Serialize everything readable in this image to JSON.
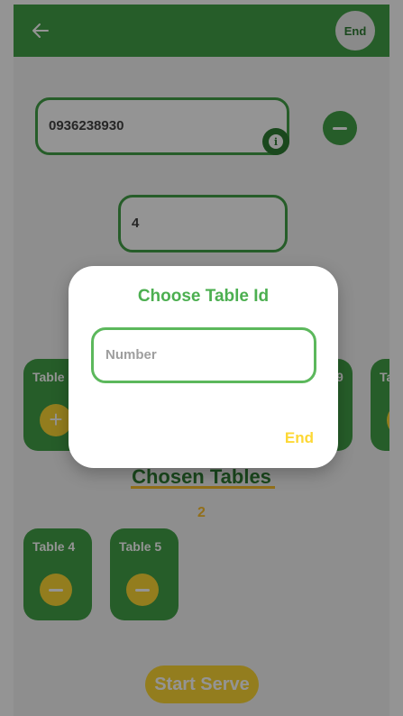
{
  "header": {
    "back_icon": "arrow-left-icon",
    "end_label": "End"
  },
  "form": {
    "phone_value": "0936238930",
    "info_icon": "info-icon",
    "count_value": "4"
  },
  "available_tables": [
    {
      "label": "Table",
      "action": "add"
    },
    {
      "label": "Ta",
      "action": "remove"
    }
  ],
  "available_partial_text": "9",
  "chosen": {
    "title": "Chosen Tables",
    "count": "2",
    "tables": [
      {
        "label": "Table 4"
      },
      {
        "label": "Table 5"
      }
    ]
  },
  "start_button": "Start Serve",
  "dialog": {
    "title": "Choose Table Id",
    "input_placeholder": "Number",
    "end_label": "End"
  },
  "colors": {
    "primary": "#43a047",
    "accent": "#fdd835",
    "dark_green": "#2e7d32"
  }
}
